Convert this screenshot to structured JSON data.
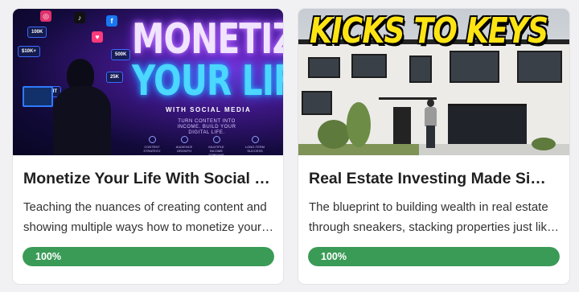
{
  "courses": [
    {
      "title": "Monetize Your Life With Social Media",
      "description": "Teaching the nuances of creating content and showing multiple ways how to monetize your content",
      "progress_label": "100%",
      "progress": 1.0,
      "progress_color": "#3a9b57",
      "thumbnail": {
        "line1": "MONETIZE",
        "line2": "YOUR LIFE",
        "tagline": "WITH SOCIAL MEDIA",
        "subline": "TURN CONTENT INTO INCOME. BUILD YOUR DIGITAL LIFE.",
        "badges": [
          "100K",
          "$10K+",
          "25K",
          "500K",
          "PROFIT"
        ],
        "features": [
          "CONTENT STRATEGY",
          "AUDIENCE GROWTH",
          "MULTIPLE INCOME STREAMS",
          "LONG-TERM SUCCESS"
        ]
      }
    },
    {
      "title": "Real Estate Investing Made Simple",
      "description": "The blueprint to building wealth in real estate through sneakers, stacking properties just like sneakers",
      "progress_label": "100%",
      "progress": 1.0,
      "progress_color": "#3a9b57",
      "thumbnail": {
        "headline": "KICKS TO KEYS"
      }
    }
  ]
}
